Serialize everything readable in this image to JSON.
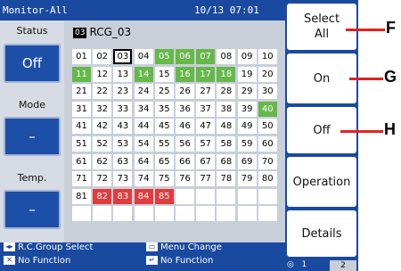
{
  "titlebar": {
    "mode": "Monitor-All",
    "datetime": "10/13 07:01"
  },
  "left": {
    "status_label": "Status",
    "status_value": "Off",
    "mode_label": "Mode",
    "mode_value": "–",
    "temp_label": "Temp.",
    "temp_value": "–"
  },
  "grid": {
    "selected_num": "03",
    "selected_name": "RCG_03",
    "cells": [
      {
        "n": "01",
        "s": "white"
      },
      {
        "n": "02",
        "s": "white"
      },
      {
        "n": "03",
        "s": "selected"
      },
      {
        "n": "04",
        "s": "white"
      },
      {
        "n": "05",
        "s": "green"
      },
      {
        "n": "06",
        "s": "green"
      },
      {
        "n": "07",
        "s": "green"
      },
      {
        "n": "08",
        "s": "white"
      },
      {
        "n": "09",
        "s": "white"
      },
      {
        "n": "10",
        "s": "white"
      },
      {
        "n": "11",
        "s": "green"
      },
      {
        "n": "12",
        "s": "white"
      },
      {
        "n": "13",
        "s": "white"
      },
      {
        "n": "14",
        "s": "green"
      },
      {
        "n": "15",
        "s": "white"
      },
      {
        "n": "16",
        "s": "green"
      },
      {
        "n": "17",
        "s": "green"
      },
      {
        "n": "18",
        "s": "green"
      },
      {
        "n": "19",
        "s": "white"
      },
      {
        "n": "20",
        "s": "white"
      },
      {
        "n": "21",
        "s": "white"
      },
      {
        "n": "22",
        "s": "white"
      },
      {
        "n": "23",
        "s": "white"
      },
      {
        "n": "24",
        "s": "white"
      },
      {
        "n": "25",
        "s": "white"
      },
      {
        "n": "26",
        "s": "white"
      },
      {
        "n": "27",
        "s": "white"
      },
      {
        "n": "28",
        "s": "white"
      },
      {
        "n": "29",
        "s": "white"
      },
      {
        "n": "30",
        "s": "white"
      },
      {
        "n": "31",
        "s": "white"
      },
      {
        "n": "32",
        "s": "white"
      },
      {
        "n": "33",
        "s": "white"
      },
      {
        "n": "34",
        "s": "white"
      },
      {
        "n": "35",
        "s": "white"
      },
      {
        "n": "36",
        "s": "white"
      },
      {
        "n": "37",
        "s": "white"
      },
      {
        "n": "38",
        "s": "white"
      },
      {
        "n": "39",
        "s": "white"
      },
      {
        "n": "40",
        "s": "green"
      },
      {
        "n": "41",
        "s": "white"
      },
      {
        "n": "42",
        "s": "white"
      },
      {
        "n": "43",
        "s": "white"
      },
      {
        "n": "44",
        "s": "white"
      },
      {
        "n": "45",
        "s": "white"
      },
      {
        "n": "46",
        "s": "white"
      },
      {
        "n": "47",
        "s": "white"
      },
      {
        "n": "48",
        "s": "white"
      },
      {
        "n": "49",
        "s": "white"
      },
      {
        "n": "50",
        "s": "white"
      },
      {
        "n": "51",
        "s": "white"
      },
      {
        "n": "52",
        "s": "white"
      },
      {
        "n": "53",
        "s": "white"
      },
      {
        "n": "54",
        "s": "white"
      },
      {
        "n": "55",
        "s": "white"
      },
      {
        "n": "56",
        "s": "white"
      },
      {
        "n": "57",
        "s": "white"
      },
      {
        "n": "58",
        "s": "white"
      },
      {
        "n": "59",
        "s": "white"
      },
      {
        "n": "60",
        "s": "white"
      },
      {
        "n": "61",
        "s": "white"
      },
      {
        "n": "62",
        "s": "white"
      },
      {
        "n": "63",
        "s": "white"
      },
      {
        "n": "64",
        "s": "white"
      },
      {
        "n": "65",
        "s": "white"
      },
      {
        "n": "66",
        "s": "white"
      },
      {
        "n": "67",
        "s": "white"
      },
      {
        "n": "68",
        "s": "white"
      },
      {
        "n": "69",
        "s": "white"
      },
      {
        "n": "70",
        "s": "white"
      },
      {
        "n": "71",
        "s": "white"
      },
      {
        "n": "72",
        "s": "white"
      },
      {
        "n": "73",
        "s": "white"
      },
      {
        "n": "74",
        "s": "white"
      },
      {
        "n": "75",
        "s": "white"
      },
      {
        "n": "76",
        "s": "white"
      },
      {
        "n": "77",
        "s": "white"
      },
      {
        "n": "78",
        "s": "white"
      },
      {
        "n": "79",
        "s": "white"
      },
      {
        "n": "80",
        "s": "white"
      },
      {
        "n": "81",
        "s": "white"
      },
      {
        "n": "82",
        "s": "red"
      },
      {
        "n": "83",
        "s": "red"
      },
      {
        "n": "84",
        "s": "red"
      },
      {
        "n": "85",
        "s": "red"
      },
      {
        "n": "",
        "s": "white"
      },
      {
        "n": "",
        "s": "white"
      },
      {
        "n": "",
        "s": "white"
      },
      {
        "n": "",
        "s": "white"
      },
      {
        "n": "",
        "s": "white"
      },
      {
        "n": "",
        "s": "white"
      },
      {
        "n": "",
        "s": "white"
      },
      {
        "n": "",
        "s": "white"
      },
      {
        "n": "",
        "s": "white"
      },
      {
        "n": "",
        "s": "white"
      },
      {
        "n": "",
        "s": "white"
      },
      {
        "n": "",
        "s": "white"
      },
      {
        "n": "",
        "s": "white"
      },
      {
        "n": "",
        "s": "white"
      },
      {
        "n": "",
        "s": "white"
      }
    ]
  },
  "right": {
    "select_all": "Select All",
    "on": "On",
    "off": "Off",
    "operation": "Operation",
    "details": "Details"
  },
  "bottom": {
    "rc_group_select": "R.C.Group Select",
    "menu_change": "Menu Change",
    "no_function_1": "No Function",
    "no_function_2": "No Function"
  },
  "pages": {
    "p1": "1",
    "p2": "2"
  },
  "callouts": {
    "f": "F",
    "g": "G",
    "h": "H"
  },
  "colors": {
    "screen_bg": "#1a4aa0",
    "group_on": "#66b84a",
    "group_error": "#e23b3b",
    "callout_arrow": "#e32121"
  }
}
